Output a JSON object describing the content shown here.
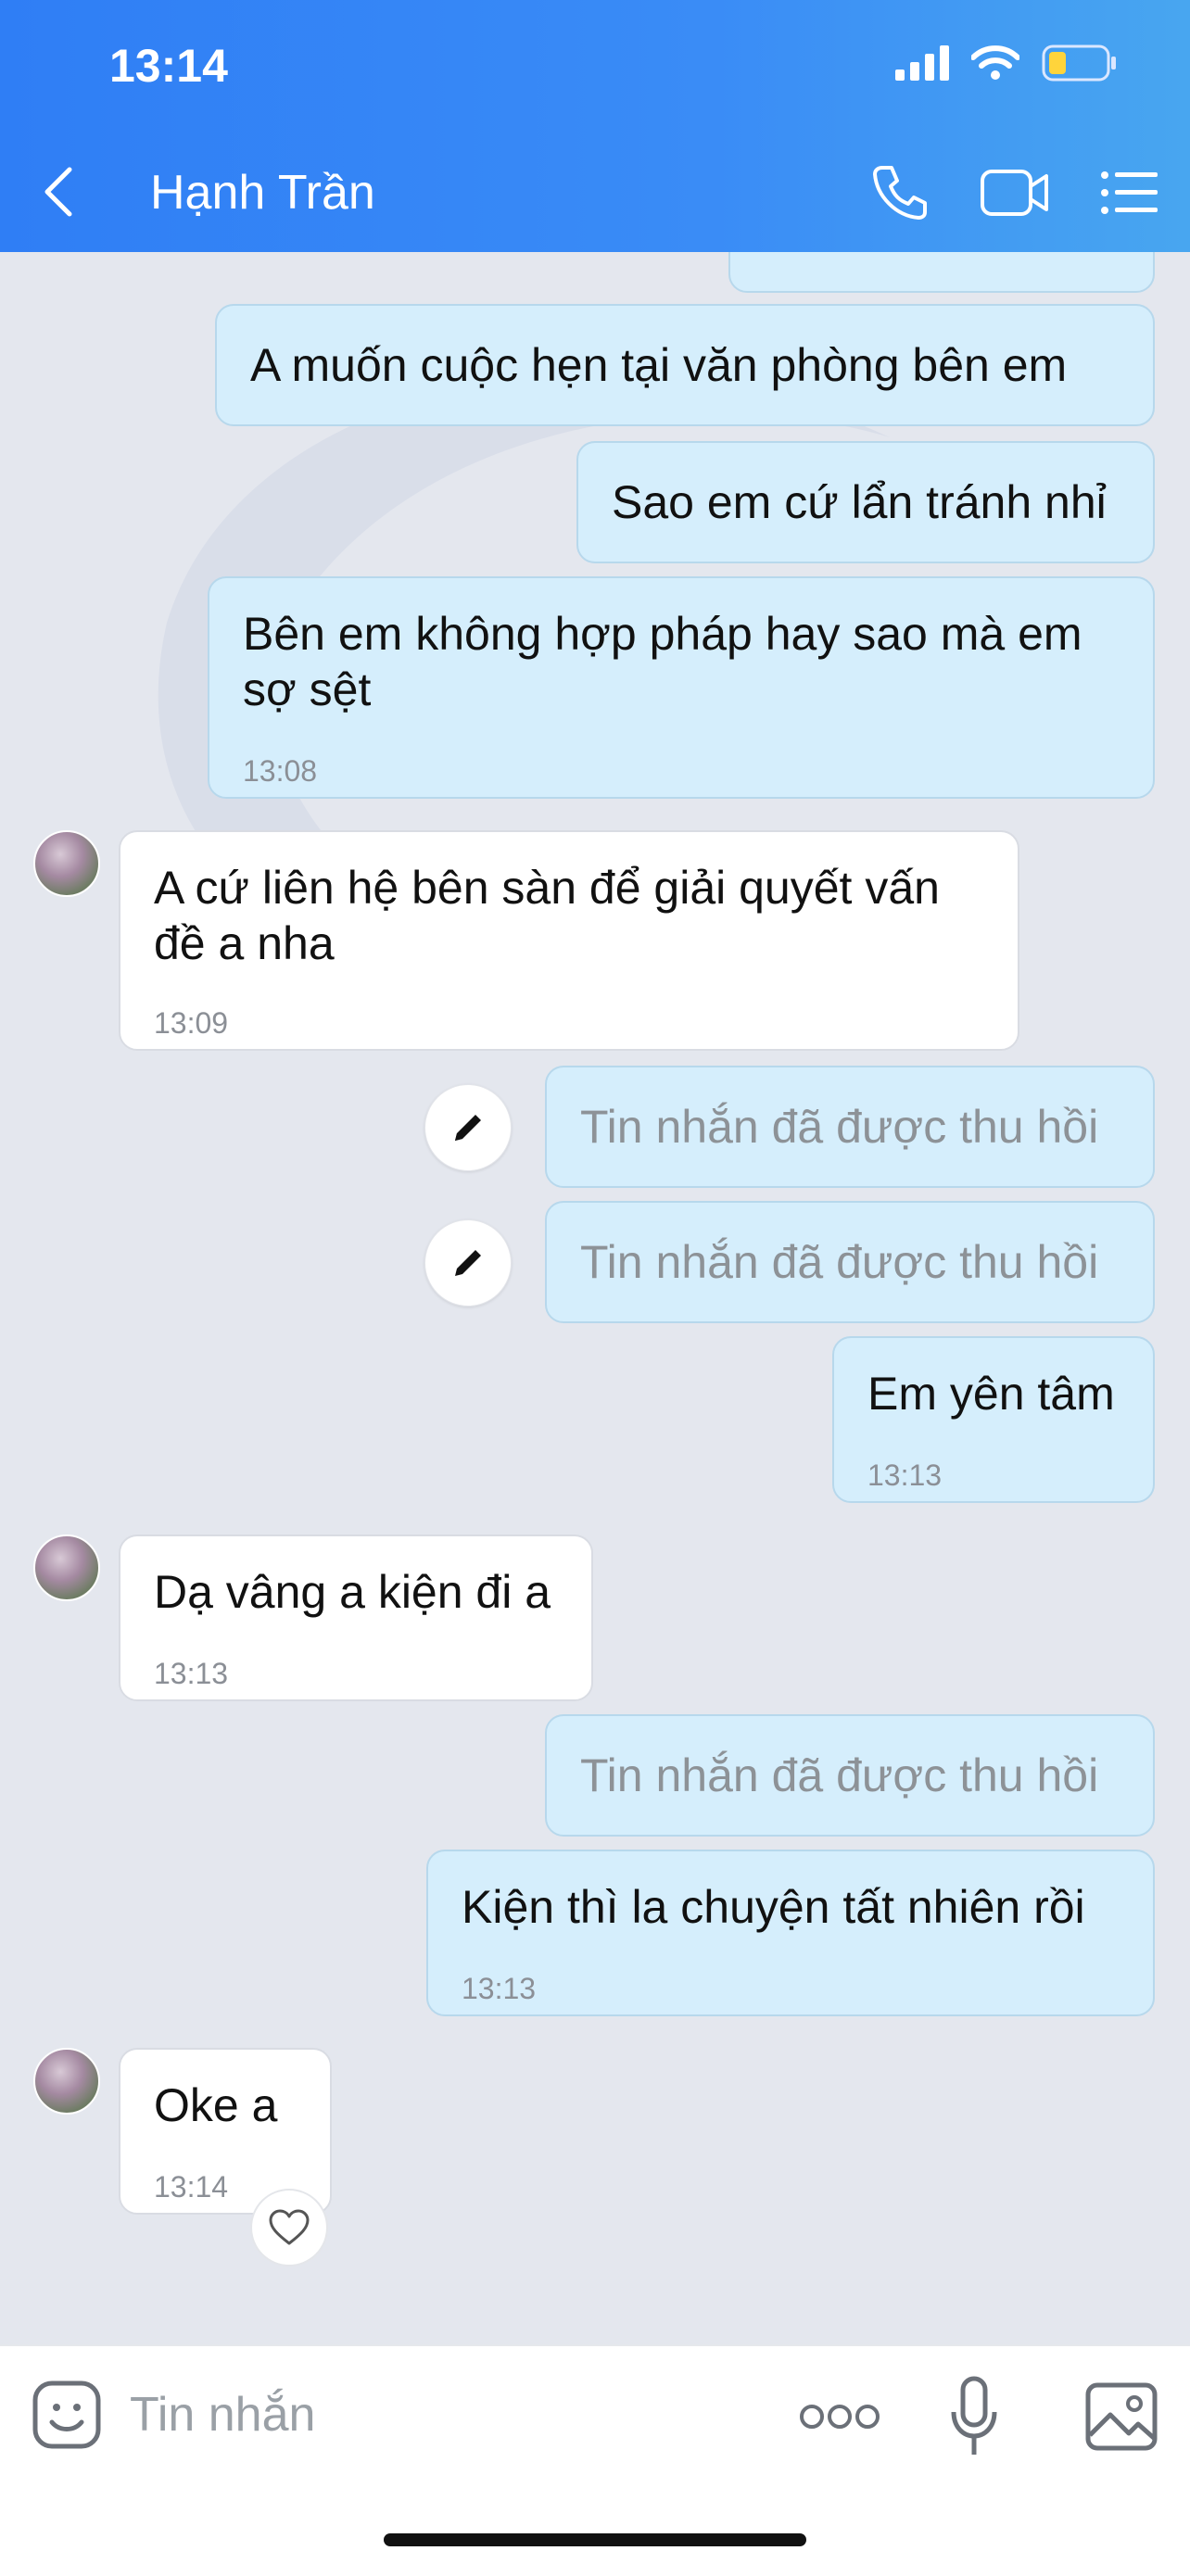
{
  "status_bar": {
    "time": "13:14"
  },
  "header": {
    "contact_name": "Hạnh Trần"
  },
  "messages": [
    {
      "dir": "out",
      "text": "A muốn cuộc hẹn tại văn phòng bên em",
      "time": ""
    },
    {
      "dir": "out",
      "text": "Sao em cứ lẩn tránh nhỉ",
      "time": ""
    },
    {
      "dir": "out",
      "text": "Bên em không hợp pháp hay sao mà em sợ sệt",
      "time": "13:08"
    },
    {
      "dir": "in",
      "text": "A cứ liên hệ bên sàn để giải quyết vấn đề a nha",
      "time": "13:09"
    },
    {
      "dir": "out",
      "text": "Tin nhắn đã được thu hồi",
      "time": ""
    },
    {
      "dir": "out",
      "text": "Tin nhắn đã được thu hồi",
      "time": ""
    },
    {
      "dir": "out",
      "text": "Em yên tâm",
      "time": "13:13"
    },
    {
      "dir": "in",
      "text": "Dạ vâng a kiện đi a",
      "time": "13:13"
    },
    {
      "dir": "out",
      "text": "Tin nhắn đã được thu hồi",
      "time": ""
    },
    {
      "dir": "out",
      "text": "Kiện thì la chuyện tất nhiên rồi",
      "time": "13:13"
    },
    {
      "dir": "in",
      "text": "Oke a",
      "time": "13:14"
    }
  ],
  "composer": {
    "placeholder": "Tin nhắn"
  },
  "colors": {
    "header": "#2f7ef5",
    "outgoing_bubble": "#d5eefc",
    "incoming_bubble": "#ffffff",
    "chat_bg": "#e4e7ee"
  }
}
